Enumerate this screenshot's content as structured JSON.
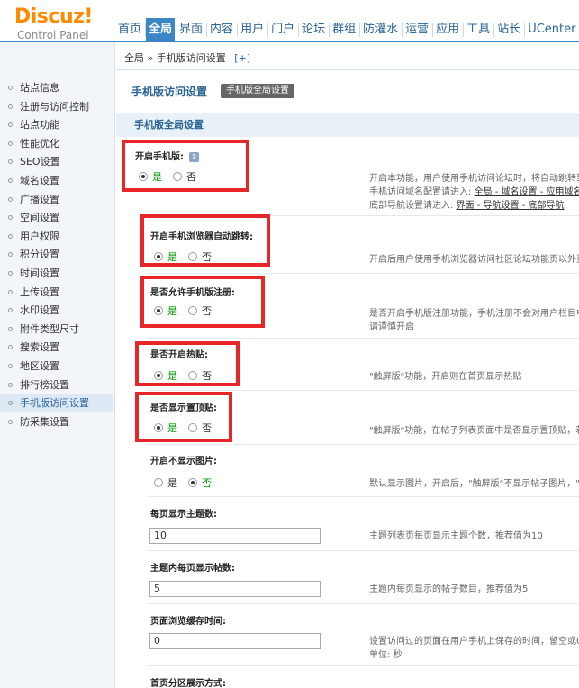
{
  "logo": {
    "brand": "Discuz!",
    "sub": "Control Panel"
  },
  "topnav": [
    "首页",
    "全局",
    "界面",
    "内容",
    "用户",
    "门户",
    "论坛",
    "群组",
    "防灌水",
    "运营",
    "应用",
    "工具",
    "站长",
    "UCenter"
  ],
  "topnav_active": "全局",
  "sidebar": [
    "站点信息",
    "注册与访问控制",
    "站点功能",
    "性能优化",
    "SEO设置",
    "域名设置",
    "广播设置",
    "空间设置",
    "用户权限",
    "积分设置",
    "时间设置",
    "上传设置",
    "水印设置",
    "附件类型尺寸",
    "搜索设置",
    "地区设置",
    "排行榜设置",
    "手机版访问设置",
    "防采集设置"
  ],
  "sidebar_active": "手机版访问设置",
  "breadcrumb": {
    "path": "全局 » 手机版访问设置",
    "plus": "[+]"
  },
  "page_title": "手机版访问设置",
  "global_button": "手机版全局设置",
  "section_title": "手机版全局设置",
  "options": {
    "yes": "是",
    "no": "否"
  },
  "settings": {
    "s1": {
      "label": "开启手机版:",
      "value": "是",
      "help": "?",
      "desc1": "开启本功能，用户使用手机访问论坛时，将自动跳转到",
      "desc2": "手机访问域名配置请进入:",
      "desc2_link": "全局 - 域名设置 - 应用域名",
      "desc3": "底部导航设置请进入:",
      "desc3_link": "界面 - 导航设置 - 底部导航"
    },
    "s2": {
      "label": "开启手机浏览器自动跳转:",
      "value": "是",
      "desc1": "开启后用户使用手机浏览器访问社区论坛功能页以外页"
    },
    "s3": {
      "label": "是否允许手机版注册:",
      "value": "是",
      "desc1": "是否开启手机版注册功能，手机注册不会对用户栏目中",
      "desc2": "请谨慎开启"
    },
    "s4": {
      "label": "是否开启热贴:",
      "value": "是",
      "desc1": "\"触屏版\"功能，开启则在首页显示热贴"
    },
    "s5": {
      "label": "是否显示置顶贴:",
      "value": "是",
      "desc1": "\"触屏版\"功能，在帖子列表页面中是否显示置顶贴，若"
    },
    "s6": {
      "label": "开启不显示图片:",
      "value": "否",
      "desc1": "默认显示图片，开启后，\"触屏版\"不显示帖子图片，\""
    },
    "s7": {
      "label": "每页显示主题数:",
      "value": "10",
      "desc1": "主题列表页每页显示主题个数，推荐值为10"
    },
    "s8": {
      "label": "主题内每页显示帖数:",
      "value": "5",
      "desc1": "主题内每页显示的帖子数目，推荐值为5"
    },
    "s9": {
      "label": "页面浏览缓存时间:",
      "value": "0",
      "desc1": "设置访问过的页面在用户手机上保存的时间，留空或0",
      "desc2": "单位: 秒"
    },
    "s10": {
      "label": "首页分区展示方式:"
    }
  },
  "colors": {
    "accent": "#3d86c6",
    "highlight_box": "#e8262a",
    "logo": "#ff8a00"
  }
}
